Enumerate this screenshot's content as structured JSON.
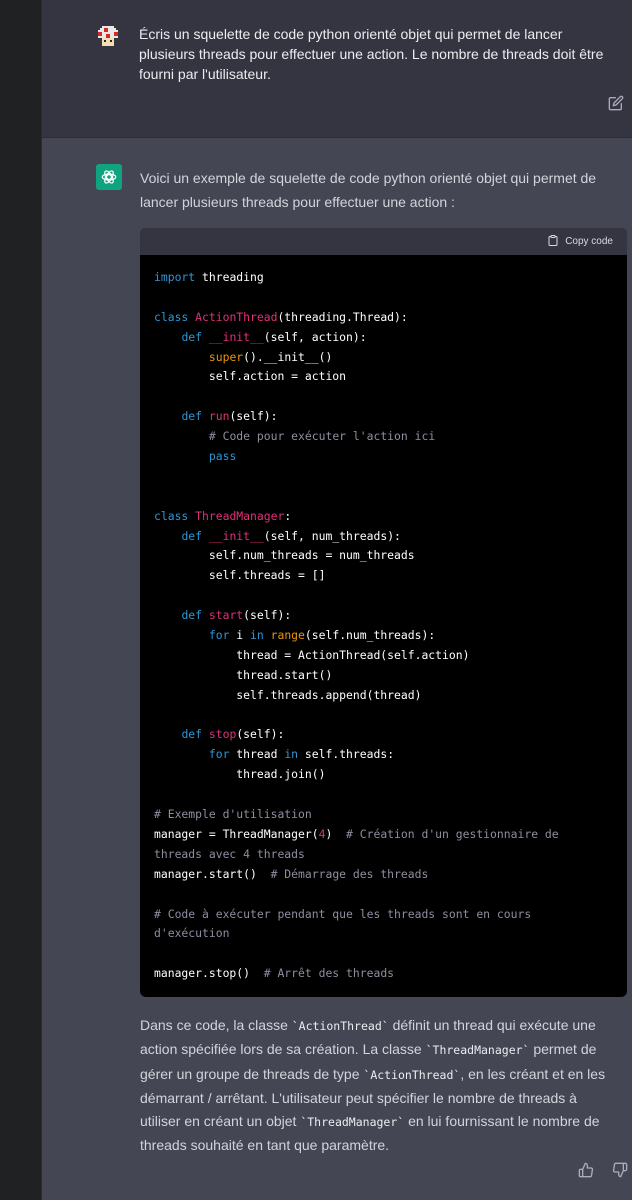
{
  "user_message": {
    "text": "Écris un squelette de code python orienté objet qui permet de lancer plusieurs threads pour effectuer une action. Le nombre de threads doit être fourni par l'utilisateur."
  },
  "assistant_message": {
    "intro": "Voici un exemple de squelette de code python orienté objet qui permet de lancer plusieurs threads pour effectuer une action :",
    "copy_label": "Copy code",
    "outro": {
      "p1": "Dans ce code, la classe ",
      "c1": "`ActionThread`",
      "p2": " définit un thread qui exécute une action spécifiée lors de sa création. La classe ",
      "c2": "`ThreadManager`",
      "p3": " permet de gérer un groupe de threads de type ",
      "c3": "`ActionThread`",
      "p4": ", en les créant et en les démarrant / arrêtant. L'utilisateur peut spécifier le nombre de threads à utiliser en créant un objet ",
      "c4": "`ThreadManager`",
      "p5": " en lui fournissant le nombre de threads souhaité en tant que paramètre."
    }
  },
  "code_lines": [
    [
      [
        "kw",
        "import"
      ],
      [
        "t",
        " threading"
      ]
    ],
    [],
    [
      [
        "kw",
        "class"
      ],
      [
        "t",
        " "
      ],
      [
        "cls",
        "ActionThread"
      ],
      [
        "t",
        "(threading.Thread):"
      ]
    ],
    [
      [
        "t",
        "    "
      ],
      [
        "kw",
        "def"
      ],
      [
        "t",
        " "
      ],
      [
        "fn",
        "__init__"
      ],
      [
        "t",
        "(self, action):"
      ]
    ],
    [
      [
        "t",
        "        "
      ],
      [
        "bi",
        "super"
      ],
      [
        "t",
        "().__init__()"
      ]
    ],
    [
      [
        "t",
        "        self.action = action"
      ]
    ],
    [],
    [
      [
        "t",
        "    "
      ],
      [
        "kw",
        "def"
      ],
      [
        "t",
        " "
      ],
      [
        "fn",
        "run"
      ],
      [
        "t",
        "(self):"
      ]
    ],
    [
      [
        "t",
        "        "
      ],
      [
        "cm",
        "# Code pour exécuter l'action ici"
      ]
    ],
    [
      [
        "t",
        "        "
      ],
      [
        "kw",
        "pass"
      ]
    ],
    [],
    [],
    [
      [
        "kw",
        "class"
      ],
      [
        "t",
        " "
      ],
      [
        "cls",
        "ThreadManager"
      ],
      [
        "t",
        ":"
      ]
    ],
    [
      [
        "t",
        "    "
      ],
      [
        "kw",
        "def"
      ],
      [
        "t",
        " "
      ],
      [
        "fn",
        "__init__"
      ],
      [
        "t",
        "(self, num_threads):"
      ]
    ],
    [
      [
        "t",
        "        self.num_threads = num_threads"
      ]
    ],
    [
      [
        "t",
        "        self.threads = []"
      ]
    ],
    [],
    [
      [
        "t",
        "    "
      ],
      [
        "kw",
        "def"
      ],
      [
        "t",
        " "
      ],
      [
        "fn",
        "start"
      ],
      [
        "t",
        "(self):"
      ]
    ],
    [
      [
        "t",
        "        "
      ],
      [
        "kw",
        "for"
      ],
      [
        "t",
        " i "
      ],
      [
        "kw",
        "in"
      ],
      [
        "t",
        " "
      ],
      [
        "bi",
        "range"
      ],
      [
        "t",
        "(self.num_threads):"
      ]
    ],
    [
      [
        "t",
        "            thread = ActionThread(self.action)"
      ]
    ],
    [
      [
        "t",
        "            thread.start()"
      ]
    ],
    [
      [
        "t",
        "            self.threads.append(thread)"
      ]
    ],
    [],
    [
      [
        "t",
        "    "
      ],
      [
        "kw",
        "def"
      ],
      [
        "t",
        " "
      ],
      [
        "fn",
        "stop"
      ],
      [
        "t",
        "(self):"
      ]
    ],
    [
      [
        "t",
        "        "
      ],
      [
        "kw",
        "for"
      ],
      [
        "t",
        " thread "
      ],
      [
        "kw",
        "in"
      ],
      [
        "t",
        " self.threads:"
      ]
    ],
    [
      [
        "t",
        "            thread.join()"
      ]
    ],
    [],
    [
      [
        "cm",
        "# Exemple d'utilisation"
      ]
    ],
    [
      [
        "t",
        "manager = ThreadManager("
      ],
      [
        "num",
        "4"
      ],
      [
        "t",
        ")  "
      ],
      [
        "cm",
        "# Création d'un gestionnaire de"
      ]
    ],
    [
      [
        "cm",
        "threads avec 4 threads"
      ]
    ],
    [
      [
        "t",
        "manager.start()  "
      ],
      [
        "cm",
        "# Démarrage des threads"
      ]
    ],
    [],
    [
      [
        "cm",
        "# Code à exécuter pendant que les threads sont en cours"
      ]
    ],
    [
      [
        "cm",
        "d'exécution"
      ]
    ],
    [],
    [
      [
        "t",
        "manager.stop()  "
      ],
      [
        "cm",
        "# Arrêt des threads"
      ]
    ]
  ],
  "colors": {
    "user_bg": "#343541",
    "assistant_bg": "#444654",
    "code_bg": "#000000",
    "keyword": "#2e95d3",
    "class_name": "#df3079",
    "builtin": "#e9950c",
    "comment": "#8e8ea0",
    "gpt_avatar": "#10a37f"
  },
  "icons": [
    "mushroom-avatar-icon",
    "openai-logo-icon",
    "edit-icon",
    "clipboard-icon",
    "thumbs-up-icon",
    "thumbs-down-icon"
  ]
}
